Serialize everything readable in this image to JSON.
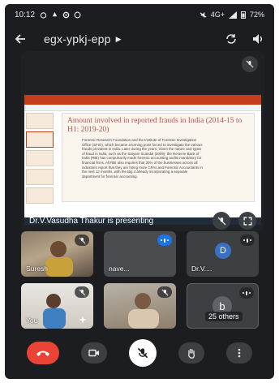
{
  "status_bar": {
    "time": "10:12",
    "signal": "4G+ ",
    "battery": "72%"
  },
  "header": {
    "meeting_code": "egx-ypkj-epp"
  },
  "stage": {
    "presenter_label": "Dr.V.Vasudha Thakur is presenting",
    "slide_title": "Amount involved in reported frauds in India (2014-15 to H1: 2019-20)",
    "slide_body": "Forensic Research Foundation and the Institute of Forensic Investigation Office (SFIO), which became a turning point forced to investigate the various frauds prevalent in India. Later during the years. Given the nature and types of fraud in India, such as the Satyam Scandal (2009), the Reserve Bank of India (RBI) has compulsorily made forensic accounting audits mandatory for financial firms. All RBI also requires that 20% of the businesses across all industries report that they are hiring more CPAs and Forensic Accountants in the next 12 months, with the Big 4 already incorporating a separate department for forensic accounting."
  },
  "participants": [
    {
      "name": "Suresh",
      "muted": true
    },
    {
      "name": "nave...",
      "muted": false
    },
    {
      "name": "Dr.V....",
      "initial": "D",
      "muted": false
    },
    {
      "name": "You",
      "muted": true
    },
    {
      "name": "",
      "muted": true
    },
    {
      "name": "",
      "initial": "b",
      "others_label": "25 others"
    }
  ],
  "colors": {
    "end_call": "#ea4335",
    "speaking_badge": "#1a73e8",
    "background": "#1c1d20"
  }
}
